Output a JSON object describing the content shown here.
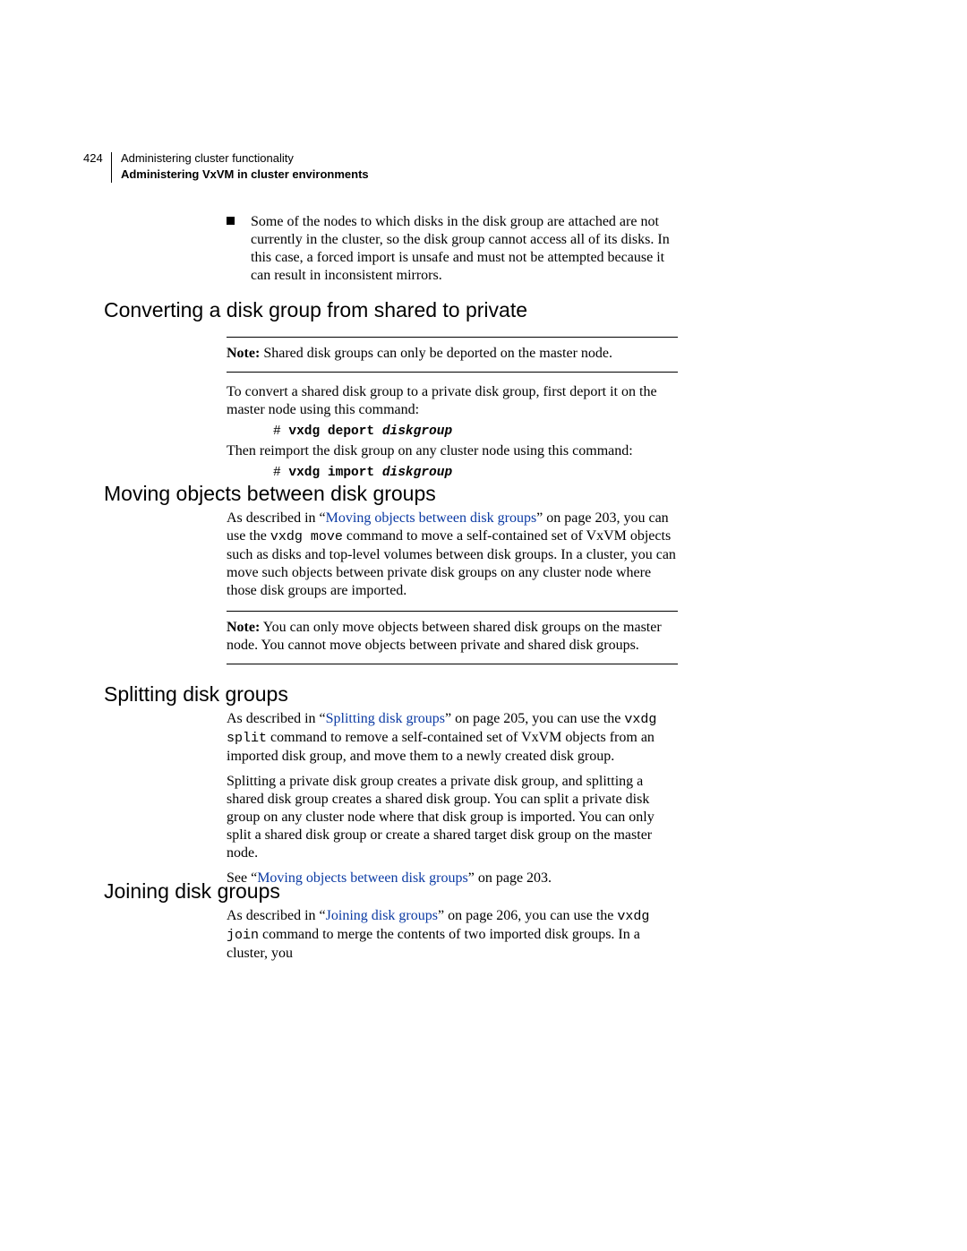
{
  "header": {
    "page_number": "424",
    "chapter_title": "Administering cluster functionality",
    "section_title": "Administering VxVM in cluster environments"
  },
  "bullet1": "Some of the nodes to which disks in the disk group are attached are not currently in the cluster, so the disk group cannot access all of its disks. In this case, a forced import is unsafe and must not be attempted because it can result in inconsistent mirrors.",
  "h2": {
    "convert": "Converting a disk group from shared to private",
    "moving": "Moving objects between disk groups",
    "splitting": "Splitting disk groups",
    "joining": "Joining disk groups"
  },
  "convert": {
    "note_label": "Note:",
    "note_text": " Shared disk groups can only be deported on the master node.",
    "p1": "To convert a shared disk group to a private disk group, first deport it on the master node using this command:",
    "cmd1_hash": "# ",
    "cmd1_cmd": "vxdg deport ",
    "cmd1_arg": "diskgroup",
    "p2": "Then reimport the disk group on any cluster node using this command:",
    "cmd2_hash": "# ",
    "cmd2_cmd": "vxdg import ",
    "cmd2_arg": "diskgroup"
  },
  "moving": {
    "p1a": "As described in “",
    "p1_link": "Moving objects between disk groups",
    "p1b": "” on page 203, you can use the ",
    "p1_code": "vxdg move",
    "p1c": " command to move a self-contained set of VxVM objects such as disks and top-level volumes between disk groups. In a cluster, you can move such objects between private disk groups on any cluster node where those disk groups are imported.",
    "note_label": "Note:",
    "note_text": " You can only move objects between shared disk groups on the master node. You cannot move objects between private and shared disk groups."
  },
  "splitting": {
    "p1a": "As described in “",
    "p1_link": "Splitting disk groups",
    "p1b": "” on page 205, you can use the ",
    "p1_code": "vxdg split",
    "p1c": " command to remove a self-contained set of VxVM objects from an imported disk group, and move them to a newly created disk group.",
    "p2": "Splitting a private disk group creates a private disk group, and splitting a shared disk group creates a shared disk group. You can split a private disk group on any cluster node where that disk group is imported. You can only split a shared disk group or create a shared target disk group on the master node.",
    "p3a": "See “",
    "p3_link": "Moving objects between disk groups",
    "p3b": "” on page 203."
  },
  "joining": {
    "p1a": "As described in “",
    "p1_link": "Joining disk groups",
    "p1b": "” on page 206, you can use the ",
    "p1_code": "vxdg join",
    "p1c": " command to merge the contents of two imported disk groups. In a cluster, you"
  }
}
